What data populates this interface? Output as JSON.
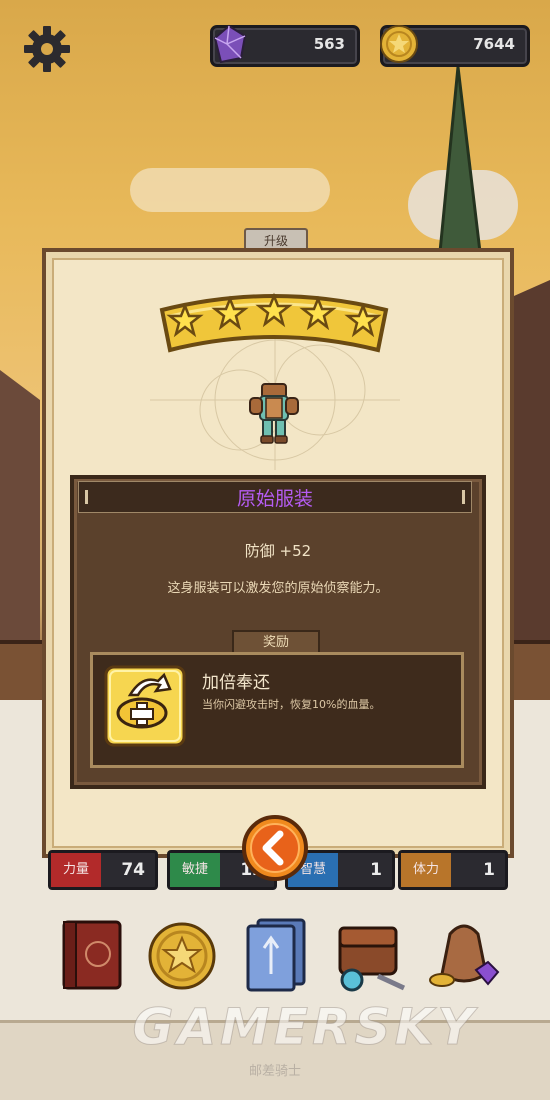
{
  "top_bar": {
    "settings_icon": "gear-icon",
    "gems": {
      "icon": "purple-gem-icon",
      "value": "563"
    },
    "coins": {
      "icon": "gold-coin-icon",
      "value": "7644"
    }
  },
  "upgrade_panel": {
    "tab_label": "升级",
    "stars": 5,
    "item_name": "原始服装",
    "defense": "防御 +52",
    "description": "这身服装可以激发您的原始侦察能力。",
    "reward": {
      "tab_label": "奖励",
      "icon": "dodge-heal-icon",
      "name": "加倍奉还",
      "description": "当你闪避攻击时，恢复10%的血量。"
    },
    "back_icon": "chevron-left-icon"
  },
  "stats": [
    {
      "label": "力量",
      "value": "74",
      "color": "#b22a2a"
    },
    {
      "label": "敏捷",
      "value": "12",
      "color": "#2e8a4a"
    },
    {
      "label": "智慧",
      "value": "1",
      "color": "#2a6fb2"
    },
    {
      "label": "体力",
      "value": "1",
      "color": "#b8752a"
    }
  ],
  "bottom_menu": [
    {
      "icon": "spellbook-icon"
    },
    {
      "icon": "star-coin-icon"
    },
    {
      "icon": "cards-icon"
    },
    {
      "icon": "backpack-icon"
    },
    {
      "icon": "treasure-bag-icon"
    }
  ],
  "watermark": {
    "text": "GAMERSKY",
    "subtext": "邮差骑士"
  },
  "colors": {
    "item_name": "#b55cf2",
    "panel": "#f3e6c6",
    "info_box": "#5b412c"
  }
}
